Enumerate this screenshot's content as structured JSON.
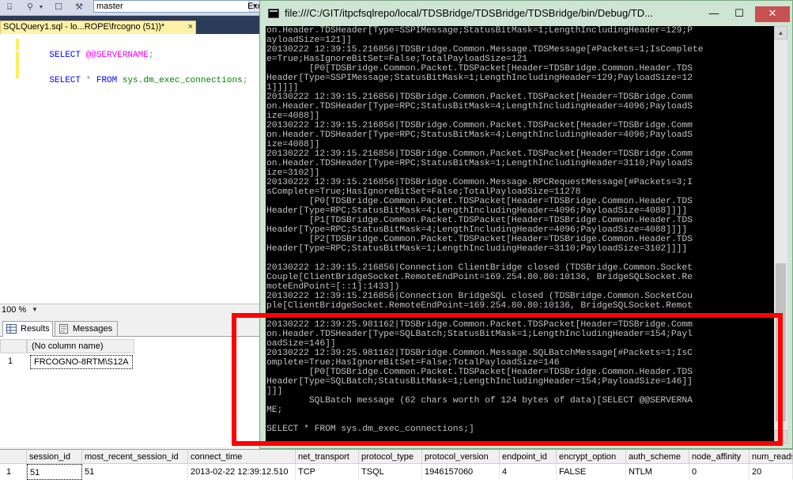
{
  "toolbar": {
    "database": "master",
    "execute_label": "Exe"
  },
  "editor": {
    "tab_label": "SQLQuery1.sql - lo...ROPE\\frcogno (51))*",
    "tab_close": "×",
    "line1": {
      "kw": "SELECT",
      "sysvar": "@@SERVERNAME",
      "end": ";"
    },
    "line2": {
      "kw1": "SELECT",
      "star": "*",
      "kw2": "FROM",
      "ident": "sys.dm_exec_connections",
      "end": ";"
    },
    "zoom": "100 %"
  },
  "results": {
    "tabs": [
      {
        "label": "Results",
        "icon": "grid-icon"
      },
      {
        "label": "Messages",
        "icon": "messages-icon"
      }
    ],
    "grid1": {
      "header": "(No column name)",
      "row_num": "1",
      "value": "FRCOGNO-8RTM\\S12A"
    },
    "grid2": {
      "columns": [
        "",
        "session_id",
        "most_recent_session_id",
        "connect_time",
        "net_transport",
        "protocol_type",
        "protocol_version",
        "endpoint_id",
        "encrypt_option",
        "auth_scheme",
        "node_affinity",
        "num_reads"
      ],
      "row": [
        "1",
        "51",
        "51",
        "2013-02-22 12:39:12.510",
        "TCP",
        "TSQL",
        "1946157060",
        "4",
        "FALSE",
        "NTLM",
        "0",
        "20"
      ]
    }
  },
  "console": {
    "title": "file:///C:/GIT/itpcfsqlrepo/local/TDSBridge/TDSBridge/TDSBridge/bin/Debug/TD...",
    "minimize": "—",
    "maximize": "☐",
    "close": "✕",
    "lines": [
      "on.Header.TDSHeader[Type=SSPIMessage;StatusBitMask=1;LengthIncludingHeader=129;P",
      "ayloadSize=121]]",
      "20130222 12:39:15.216856|TDSBridge.Common.Message.TDSMessage[#Packets=1;IsComplete",
      "e=True;HasIgnoreBitSet=False;TotalPayloadSize=121",
      "        [P0[TDSBridge.Common.Packet.TDSPacket[Header=TDSBridge.Common.Header.TDS",
      "Header[Type=SSPIMessage;StatusBitMask=1;LengthIncludingHeader=129;PayloadSize=12",
      "1]]]]]",
      "20130222 12:39:15.216856|TDSBridge.Common.Packet.TDSPacket[Header=TDSBridge.Comm",
      "on.Header.TDSHeader[Type=RPC;StatusBitMask=4;LengthIncludingHeader=4096;PayloadS",
      "ize=4088]]",
      "20130222 12:39:15.216856|TDSBridge.Common.Packet.TDSPacket[Header=TDSBridge.Comm",
      "on.Header.TDSHeader[Type=RPC;StatusBitMask=4;LengthIncludingHeader=4096;PayloadS",
      "ize=4088]]",
      "20130222 12:39:15.216856|TDSBridge.Common.Packet.TDSPacket[Header=TDSBridge.Comm",
      "on.Header.TDSHeader[Type=RPC;StatusBitMask=1;LengthIncludingHeader=3110;PayloadS",
      "ize=3102]]",
      "20130222 12:39:15.216856|TDSBridge.Common.Message.RPCRequestMessage[#Packets=3;I",
      "sComplete=True;HasIgnoreBitSet=False;TotalPayloadSize=11278",
      "        [P0[TDSBridge.Common.Packet.TDSPacket[Header=TDSBridge.Common.Header.TDS",
      "Header[Type=RPC;StatusBitMask=4;LengthIncludingHeader=4096;PayloadSize=4088]]]]",
      "        [P1[TDSBridge.Common.Packet.TDSPacket[Header=TDSBridge.Common.Header.TDS",
      "Header[Type=RPC;StatusBitMask=4;LengthIncludingHeader=4096;PayloadSize=4088]]]]",
      "        [P2[TDSBridge.Common.Packet.TDSPacket[Header=TDSBridge.Common.Header.TDS",
      "Header[Type=RPC;StatusBitMask=1;LengthIncludingHeader=3110;PayloadSize=3102]]]]",
      "",
      "20130222 12:39:15.216856|Connection ClientBridge closed (TDSBridge.Common.Socket",
      "Couple[ClientBridgeSocket.RemoteEndPoint=169.254.80.80:10136, BridgeSQLSocket.Re",
      "moteEndPoint=[::1]:1433])",
      "20130222 12:39:15.216856|Connection BridgeSQL closed (TDSBridge.Common.SocketCou",
      "ple[ClientBridgeSocket.RemoteEndPoint=169.254.80.80:10136, BridgeSQLSocket.Remot",
      "",
      "20130222 12:39:25.981162|TDSBridge.Common.Packet.TDSPacket[Header=TDSBridge.Comm",
      "on.Header.TDSHeader[Type=SQLBatch;StatusBitMask=1;LengthIncludingHeader=154;Payl",
      "oadSize=146]]",
      "20130222 12:39:25.981162|TDSBridge.Common.Message.SQLBatchMessage[#Packets=1;IsC",
      "omplete=True;HasIgnoreBitSet=False;TotalPayloadSize=146",
      "        [P0[TDSBridge.Common.Packet.TDSPacket[Header=TDSBridge.Common.Header.TDS",
      "Header[Type=SQLBatch;StatusBitMask=1;LengthIncludingHeader=154;PayloadSize=146]]",
      "]]]",
      "        SQLBatch message (62 chars worth of 124 bytes of data)[SELECT @@SERVERNA",
      "ME;",
      "",
      "SELECT * FROM sys.dm_exec_connections;]"
    ]
  }
}
